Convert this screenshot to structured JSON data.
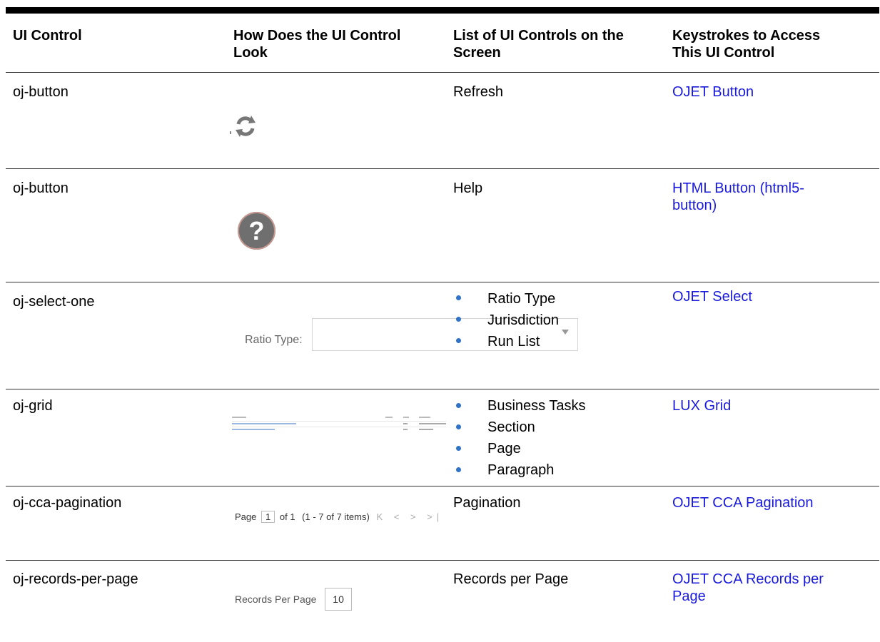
{
  "headers": [
    "UI Control",
    "How Does the UI Control Look",
    "List of UI Controls on the Screen",
    "Keystrokes to Access This UI Control"
  ],
  "header_lines": {
    "col2": [
      "How Does the UI Control",
      "Look"
    ],
    "col3": [
      "List of UI Controls on the",
      "Screen"
    ],
    "col4": [
      "Keystrokes to Access",
      "This UI Control"
    ]
  },
  "rows": [
    {
      "control": "oj-button",
      "screen": "Refresh",
      "link": "OJET Button"
    },
    {
      "control": "oj-button",
      "screen": "Help",
      "link_lines": [
        "HTML Button (html5-",
        "button)"
      ]
    },
    {
      "control": "oj-select-one",
      "screen_list": [
        "Ratio Type",
        "Jurisdiction",
        "Run List"
      ],
      "link": "OJET Select",
      "look": {
        "label": "Ratio Type:"
      }
    },
    {
      "control": "oj-grid",
      "screen_list": [
        "Business Tasks",
        "Section",
        "Page",
        "Paragraph"
      ],
      "link": "LUX Grid"
    },
    {
      "control": "oj-cca-pagination",
      "screen": "Pagination",
      "link": "OJET CCA Pagination",
      "look": {
        "page_label": "Page",
        "page_value": "1",
        "of_label": "of 1",
        "items_text": "(1 - 7 of 7 items)",
        "nav": "K < > >|"
      }
    },
    {
      "control": "oj-records-per-page",
      "screen": "Records per Page",
      "link_lines": [
        "OJET CCA Records per",
        "Page"
      ],
      "look": {
        "label": "Records Per Page",
        "value": "10"
      }
    }
  ],
  "colors": {
    "link": "#1a1adf",
    "bullet": "#2f72c7"
  },
  "icons": [
    "refresh-icon",
    "help-icon",
    "dropdown-caret-icon"
  ]
}
